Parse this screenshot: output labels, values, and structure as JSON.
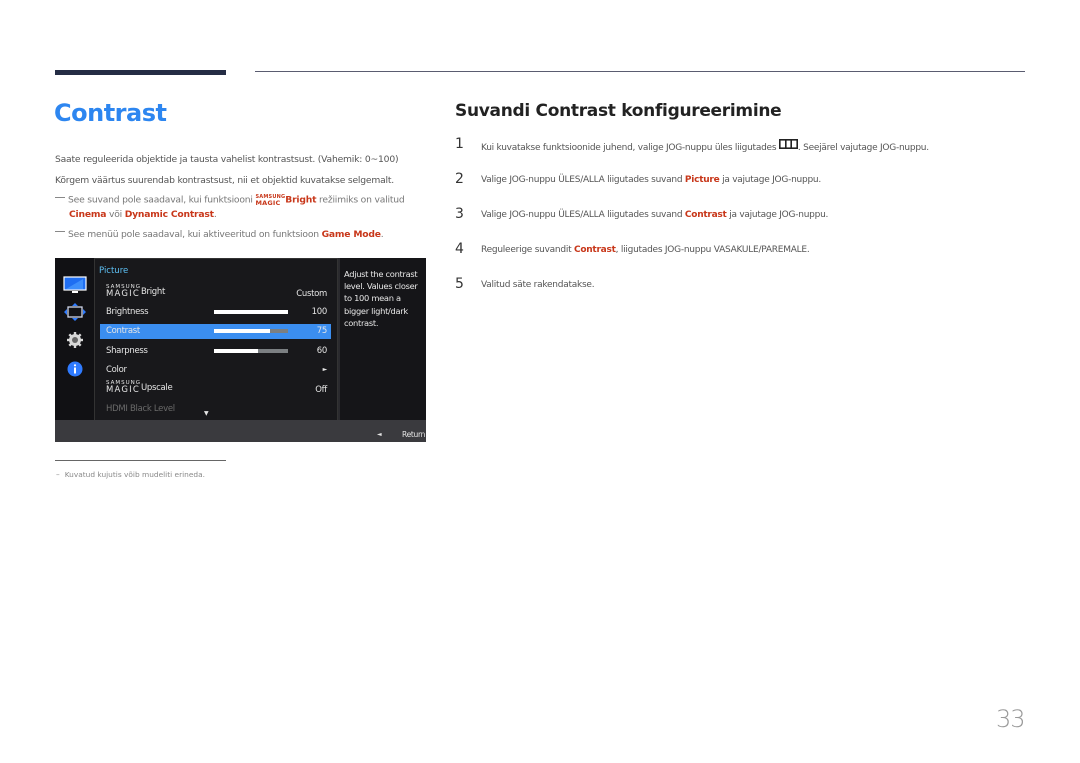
{
  "header": {
    "title": "Contrast"
  },
  "intro": {
    "line1": "Saate reguleerida objektide ja tausta vahelist kontrastsust. (Vahemik: 0~100)",
    "line2": "Kõrgem väärtus suurendab kontrastsust, nii et objektid kuvatakse selgemalt."
  },
  "notes": [
    {
      "pre": "See suvand pole saadaval, kui funktsiooni ",
      "magic_top": "SAMSUNG",
      "magic_bottom": "MAGIC",
      "bright": "Bright",
      "mid": " režiimiks on valitud",
      "opt1": "Cinema",
      "or": " või ",
      "opt2": "Dynamic Contrast",
      "end": "."
    },
    {
      "pre": "See menüü pole saadaval, kui aktiveeritud on funktsioon ",
      "hl": "Game Mode",
      "end": "."
    }
  ],
  "osd": {
    "category": "Picture",
    "side_icons": [
      "monitor-icon",
      "resize-icon",
      "gear-icon",
      "info-icon"
    ],
    "rows": [
      {
        "label_top": "SAMSUNG",
        "label_bottom": "MAGIC",
        "label_suffix": "Bright",
        "value": "Custom"
      },
      {
        "label": "Brightness",
        "value": "100",
        "level": 1.0
      },
      {
        "label": "Contrast",
        "value": "75",
        "level": 0.75,
        "selected": true
      },
      {
        "label": "Sharpness",
        "value": "60",
        "level": 0.6
      },
      {
        "label": "Color",
        "value": "►"
      },
      {
        "label_top": "SAMSUNG",
        "label_bottom": "MAGIC",
        "label_suffix": "Upscale",
        "value": "Off"
      },
      {
        "label": "HDMI Black Level",
        "disabled": true
      }
    ],
    "help": "Adjust the contrast level. Values closer to 100 mean a bigger light/dark contrast.",
    "return_label": "Return",
    "scroll_down": "▼",
    "return_arrow": "◄"
  },
  "section": {
    "title": "Suvandi Contrast konfigureerimine"
  },
  "steps": [
    {
      "num": "1",
      "pre": "Kui kuvatakse funktsioonide juhend, valige JOG-nuppu üles liigutades ",
      "post": ". Seejärel vajutage JOG-nuppu."
    },
    {
      "num": "2",
      "pre": "Valige JOG-nuppu ÜLES/ALLA liigutades suvand ",
      "hl": "Picture",
      "post": " ja vajutage JOG-nuppu."
    },
    {
      "num": "3",
      "pre": "Valige JOG-nuppu ÜLES/ALLA liigutades suvand ",
      "hl": "Contrast",
      "post": " ja vajutage JOG-nuppu."
    },
    {
      "num": "4",
      "pre": "Reguleerige suvandit ",
      "hl": "Contrast",
      "post": ", liigutades JOG-nuppu VASAKULE/PAREMALE."
    },
    {
      "num": "5",
      "pre": "Valitud säte rakendatakse."
    }
  ],
  "footer": {
    "note": "Kuvatud kujutis võib mudeliti erineda.",
    "dash": "–"
  },
  "page_number": "33"
}
